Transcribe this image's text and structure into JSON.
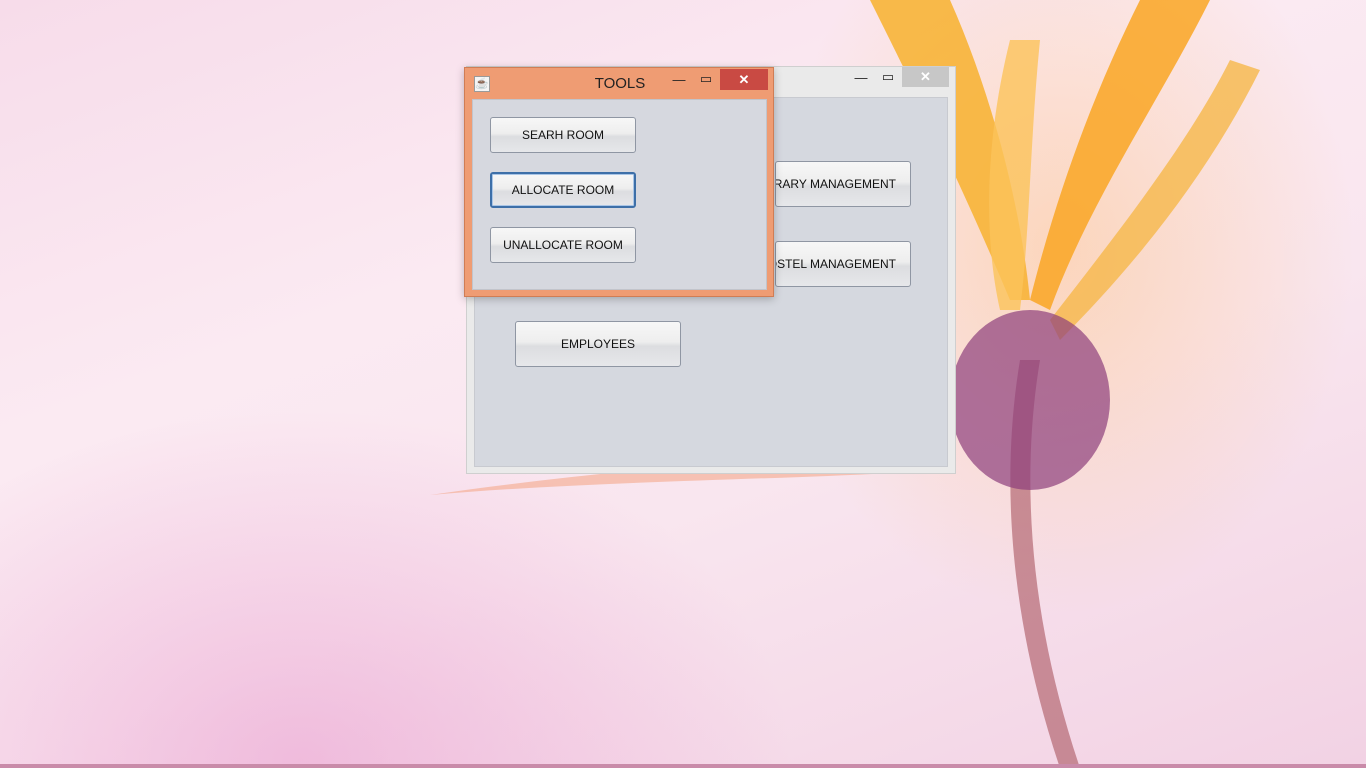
{
  "main_window": {
    "controls": {
      "minimize": "—",
      "maximize": "▭",
      "close": "✕"
    },
    "buttons": {
      "library": "LIBRARY MANAGEMENT",
      "hostel": "HOSTEL MANAGEMENT",
      "employees": "EMPLOYEES"
    }
  },
  "tools_dialog": {
    "title": "TOOLS",
    "controls": {
      "minimize": "—",
      "maximize": "▭",
      "close": "✕"
    },
    "buttons": {
      "search": "SEARH ROOM",
      "allocate": "ALLOCATE ROOM",
      "unallocate": "UNALLOCATE ROOM"
    }
  },
  "colors": {
    "dialog_frame": "#ef9c73",
    "close_button": "#c94a43",
    "client_area": "#d6d8df"
  }
}
